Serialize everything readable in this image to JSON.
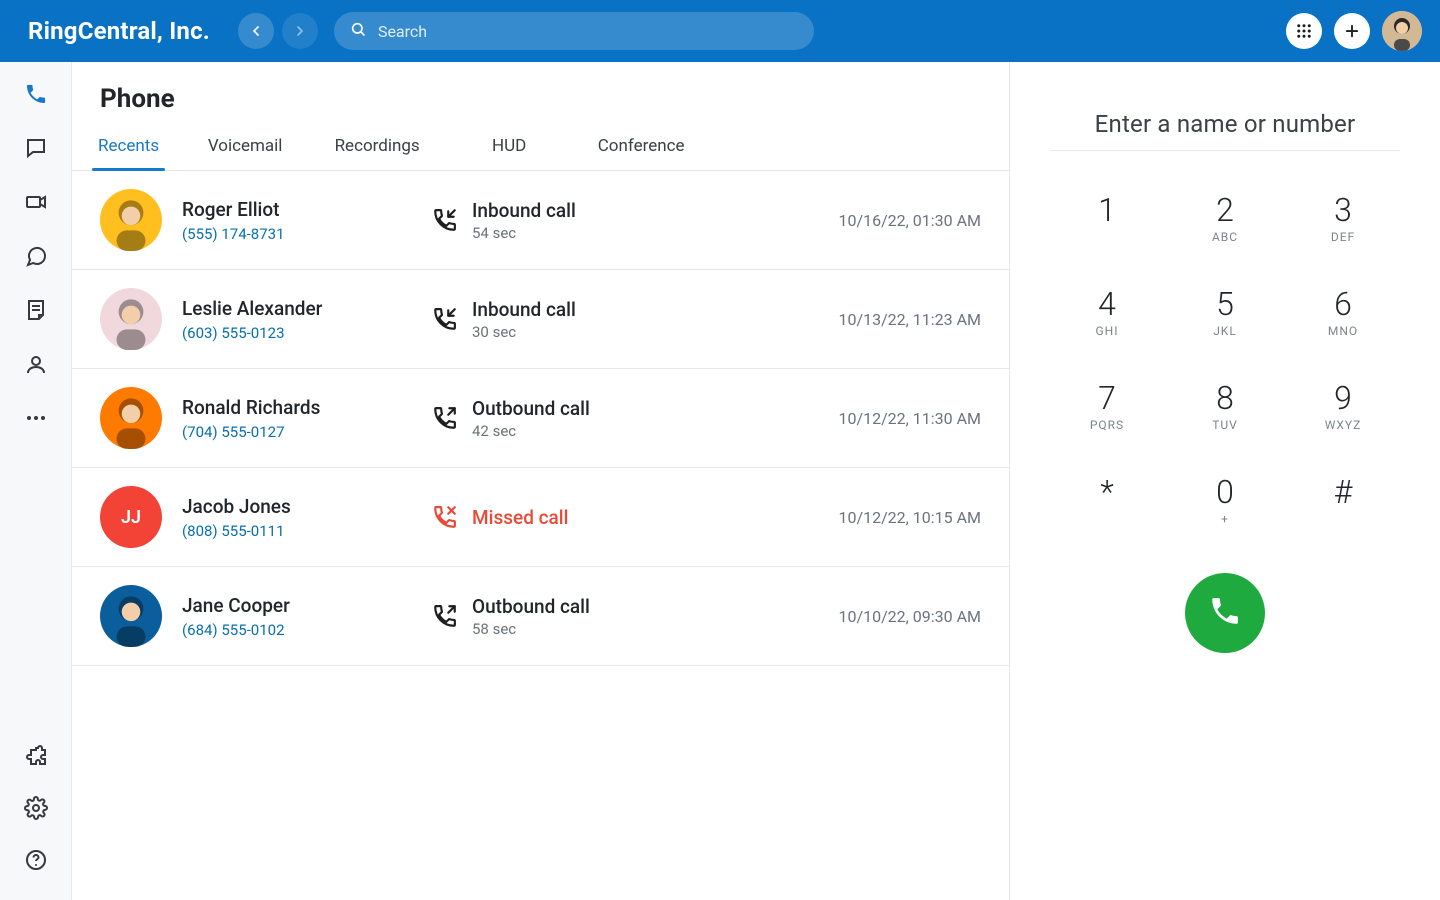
{
  "header": {
    "brand": "RingCentral, Inc.",
    "search_placeholder": "Search"
  },
  "sidebar": {
    "items": [
      {
        "id": "phone",
        "active": true
      },
      {
        "id": "messages"
      },
      {
        "id": "video"
      },
      {
        "id": "chat"
      },
      {
        "id": "tasks"
      },
      {
        "id": "contacts"
      },
      {
        "id": "more"
      }
    ]
  },
  "phone": {
    "title": "Phone",
    "tabs": [
      {
        "label": "Recents",
        "active": true
      },
      {
        "label": "Voicemail"
      },
      {
        "label": "Recordings"
      },
      {
        "label": "HUD"
      },
      {
        "label": "Conference"
      }
    ],
    "calls": [
      {
        "name": "Roger Elliot",
        "phone": "(555) 174-8731",
        "type": "Inbound call",
        "dur": "54 sec",
        "time": "10/16/22, 01:30 AM",
        "dir": "in",
        "avatar": "yellow",
        "initials": ""
      },
      {
        "name": "Leslie Alexander",
        "phone": "(603) 555-0123",
        "type": "Inbound call",
        "dur": "30 sec",
        "time": "10/13/22, 11:23 AM",
        "dir": "in",
        "avatar": "pink",
        "initials": ""
      },
      {
        "name": "Ronald Richards",
        "phone": "(704) 555-0127",
        "type": "Outbound call",
        "dur": "42 sec",
        "time": "10/12/22, 11:30 AM",
        "dir": "out",
        "avatar": "orange",
        "initials": ""
      },
      {
        "name": "Jacob Jones",
        "phone": "(808) 555-0111",
        "type": "Missed call",
        "dur": "",
        "time": "10/12/22, 10:15 AM",
        "dir": "missed",
        "avatar": "red",
        "initials": "JJ"
      },
      {
        "name": "Jane Cooper",
        "phone": "(684) 555-0102",
        "type": "Outbound call",
        "dur": "58 sec",
        "time": "10/10/22, 09:30 AM",
        "dir": "out",
        "avatar": "teal",
        "initials": ""
      }
    ]
  },
  "dialpad": {
    "placeholder": "Enter a name or number",
    "keys": [
      {
        "d": "1",
        "l": ""
      },
      {
        "d": "2",
        "l": "ABC"
      },
      {
        "d": "3",
        "l": "DEF"
      },
      {
        "d": "4",
        "l": "GHI"
      },
      {
        "d": "5",
        "l": "JKL"
      },
      {
        "d": "6",
        "l": "MNO"
      },
      {
        "d": "7",
        "l": "PQRS"
      },
      {
        "d": "8",
        "l": "TUV"
      },
      {
        "d": "9",
        "l": "WXYZ"
      },
      {
        "d": "*",
        "l": ""
      },
      {
        "d": "0",
        "l": "+"
      },
      {
        "d": "#",
        "l": ""
      }
    ]
  }
}
